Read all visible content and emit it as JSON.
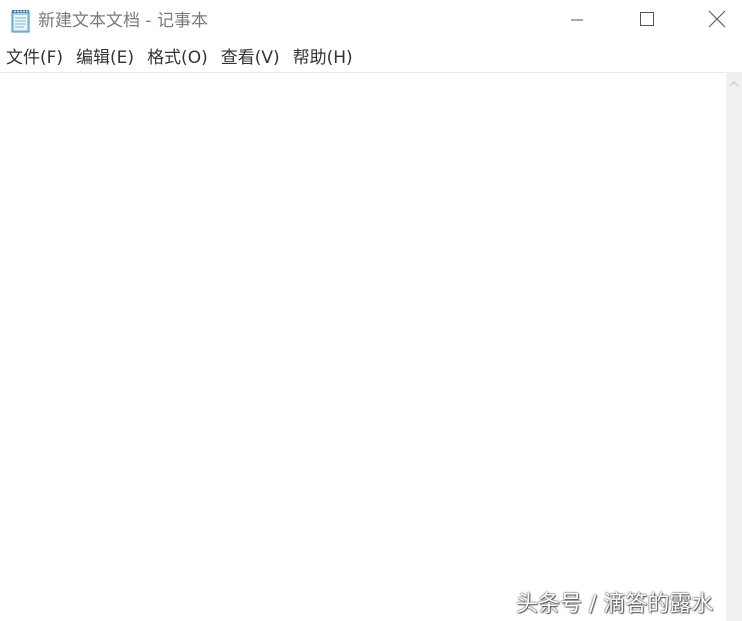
{
  "window": {
    "title": "新建文本文档 - 记事本",
    "app_icon": "notepad-icon"
  },
  "caption_buttons": {
    "minimize": "minimize-icon",
    "maximize": "maximize-icon",
    "close": "close-icon"
  },
  "menu": {
    "items": [
      {
        "label": "文件(F)"
      },
      {
        "label": "编辑(E)"
      },
      {
        "label": "格式(O)"
      },
      {
        "label": "查看(V)"
      },
      {
        "label": "帮助(H)"
      }
    ]
  },
  "editor": {
    "content": ""
  },
  "watermark": {
    "text": "头条号 / 滴答的露水"
  }
}
